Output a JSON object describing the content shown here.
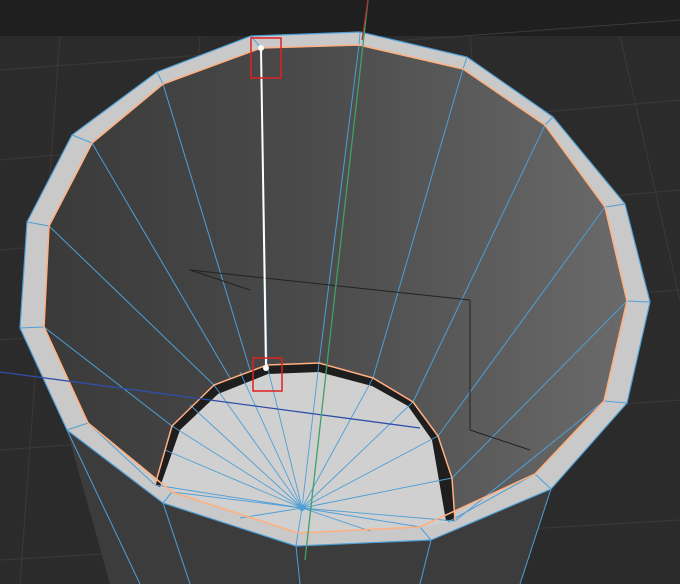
{
  "viewport": {
    "kind": "3d-viewport",
    "object": "cup-mesh",
    "colors": {
      "background": "#2b2b2b",
      "grid": "#3a3a3a",
      "header_bar": "#1f1f1f",
      "wall_outer": "#c9c9c9",
      "wall_inner_dark": "#3a3a3a",
      "wall_inner_light": "#6a6a6a",
      "bottom_face": "#d0d0d0",
      "edge_wire": "#4d9fd6",
      "selected_loop": "#ffb080",
      "selected_edge": "#ffffff",
      "axis_x": "#2f4fa8",
      "axis_y": "#3ea06a",
      "axis_z": "#b03030",
      "marker": "#e02020"
    }
  }
}
